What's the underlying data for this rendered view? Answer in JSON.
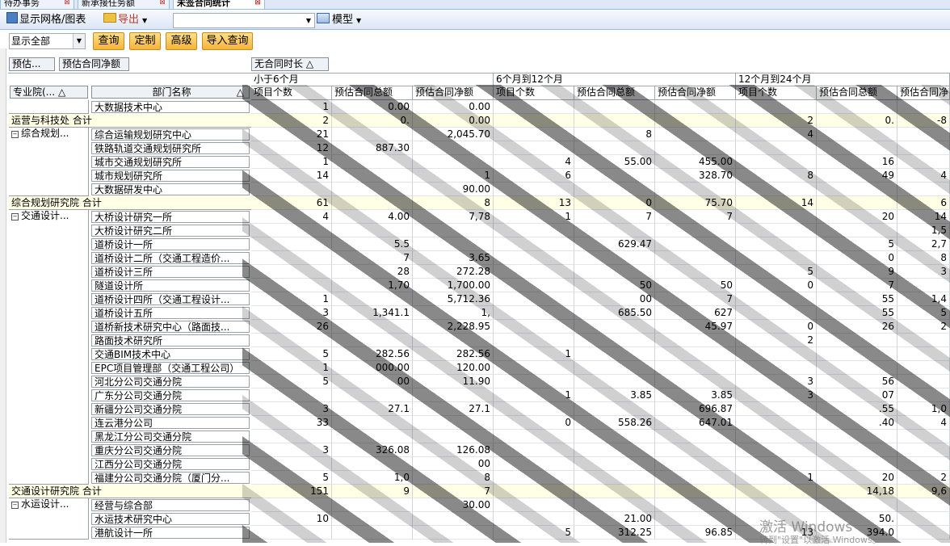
{
  "tabs": [
    {
      "label": "待办事务",
      "active": false
    },
    {
      "label": "新承接任务额",
      "active": false
    },
    {
      "label": "未签合同统计",
      "active": true
    }
  ],
  "toolbar": {
    "display_grid_chart": "显示网格/图表",
    "export": "导出",
    "search_value": "",
    "model": "模型"
  },
  "filter": {
    "show_all": "显示全部",
    "query": "查询",
    "customize": "定制",
    "advanced": "高级",
    "import_query": "导入查询"
  },
  "pivot": {
    "filter_fields": [
      "预估...",
      "预估合同净额"
    ],
    "column_field": "无合同时长 △",
    "row_fields": [
      "专业院(... △",
      "部门名称"
    ],
    "row_field_sort": "△",
    "periods": [
      "小于6个月",
      "6个月到12个月",
      "12个月到24个月"
    ],
    "measures": [
      "项目个数",
      "预估合同总额",
      "预估合同净额"
    ],
    "rows": [
      {
        "group": "",
        "dept": "大数据技术中心",
        "v": [
          "1",
          "0.00",
          "0.00",
          "",
          "",
          "",
          "",
          "",
          ""
        ],
        "total": false
      },
      {
        "group": "运营与科技处 合计",
        "dept": "",
        "v": [
          "2",
          "0.",
          "0.00",
          "",
          "",
          "",
          "2",
          "0.",
          "-8"
        ],
        "total": true
      },
      {
        "group": "综合规划...",
        "dept": "综合运输规划研究中心",
        "v": [
          "21",
          "",
          "2,045.70",
          "",
          "8",
          "",
          "4",
          "",
          ""
        ],
        "total": false,
        "expand": true
      },
      {
        "group": "",
        "dept": "铁路轨道交通规划研究所",
        "v": [
          "12",
          "887.30",
          "",
          "",
          "",
          "",
          "",
          "",
          ""
        ],
        "total": false
      },
      {
        "group": "",
        "dept": "城市交通规划研究所",
        "v": [
          "1",
          "",
          "",
          "4",
          "55.00",
          "455.00",
          "",
          "16",
          ""
        ],
        "total": false
      },
      {
        "group": "",
        "dept": "城市规划研究所",
        "v": [
          "14",
          "",
          "1",
          "6",
          "",
          "328.70",
          "8",
          "49",
          "4"
        ],
        "total": false
      },
      {
        "group": "",
        "dept": "大数据研发中心",
        "v": [
          "",
          "",
          "90.00",
          "",
          "",
          "",
          "",
          "",
          ""
        ],
        "total": false
      },
      {
        "group": "综合规划研究院 合计",
        "dept": "",
        "v": [
          "61",
          "",
          "8",
          "13",
          "0",
          "75.70",
          "14",
          "",
          "6"
        ],
        "total": true
      },
      {
        "group": "交通设计...",
        "dept": "大桥设计研究一所",
        "v": [
          "4",
          "4.00",
          "7,78",
          "1",
          "7",
          "7",
          "",
          "20",
          "14"
        ],
        "total": false,
        "expand": true
      },
      {
        "group": "",
        "dept": "大桥设计研究二所",
        "v": [
          "",
          "",
          "",
          "",
          "",
          "",
          "",
          "",
          "1,5"
        ],
        "total": false
      },
      {
        "group": "",
        "dept": "道桥设计一所",
        "v": [
          "",
          "5.5",
          "",
          "",
          "629.47",
          "",
          "",
          "5",
          "2,7"
        ],
        "total": false
      },
      {
        "group": "",
        "dept": "道桥设计二所（交通工程造价...",
        "v": [
          "",
          "7",
          "3.65",
          "",
          "",
          "",
          "",
          "0",
          "8"
        ],
        "total": false
      },
      {
        "group": "",
        "dept": "道桥设计三所",
        "v": [
          "",
          "28",
          "272.28",
          "",
          "",
          "",
          "5",
          "9",
          "3"
        ],
        "total": false
      },
      {
        "group": "",
        "dept": "隧道设计所",
        "v": [
          "",
          "1,70",
          "1,700.00",
          "",
          "50",
          "50",
          "0",
          "7",
          ""
        ],
        "total": false
      },
      {
        "group": "",
        "dept": "道桥设计四所（交通工程设计...",
        "v": [
          "1",
          "",
          "5,712.36",
          "",
          "00",
          "7",
          "",
          "55",
          "1,4"
        ],
        "total": false
      },
      {
        "group": "",
        "dept": "道桥设计五所",
        "v": [
          "3",
          "1,341.1",
          "1,",
          "",
          "685.50",
          "627",
          "",
          "55",
          "5"
        ],
        "total": false
      },
      {
        "group": "",
        "dept": "道桥新技术研究中心（路面技...",
        "v": [
          "26",
          "",
          "2,228.95",
          "",
          "",
          "45.97",
          "0",
          "26",
          "2"
        ],
        "total": false
      },
      {
        "group": "",
        "dept": "路面技术研究所",
        "v": [
          "",
          "",
          "",
          "",
          "",
          "",
          "2",
          "",
          ""
        ],
        "total": false
      },
      {
        "group": "",
        "dept": "交通BIM技术中心",
        "v": [
          "5",
          "282.56",
          "282.56",
          "1",
          "",
          "",
          "",
          "",
          ""
        ],
        "total": false
      },
      {
        "group": "",
        "dept": "EPC项目管理部（交通工程公司）",
        "v": [
          "1",
          "000.00",
          "120.00",
          "",
          "",
          "",
          "",
          "",
          ""
        ],
        "total": false
      },
      {
        "group": "",
        "dept": "河北分公司交通分院",
        "v": [
          "5",
          "00",
          "11.90",
          "",
          "",
          "",
          "3",
          "56",
          ""
        ],
        "total": false
      },
      {
        "group": "",
        "dept": "广东分公司交通分院",
        "v": [
          "",
          "",
          "",
          "1",
          "3.85",
          "3.85",
          "3",
          "07",
          ""
        ],
        "total": false
      },
      {
        "group": "",
        "dept": "新疆分公司交通分院",
        "v": [
          "3",
          "27.1",
          "27.1",
          "",
          "",
          "696.87",
          "",
          ".55",
          "1,0"
        ],
        "total": false
      },
      {
        "group": "",
        "dept": "连云港分公司",
        "v": [
          "33",
          "",
          "",
          "0",
          "558.26",
          "647.01",
          "",
          ".40",
          "4"
        ],
        "total": false
      },
      {
        "group": "",
        "dept": "黑龙江分公司交通分院",
        "v": [
          "",
          "",
          "",
          "",
          "",
          "",
          "",
          "",
          ""
        ],
        "total": false
      },
      {
        "group": "",
        "dept": "重庆分公司交通分院",
        "v": [
          "3",
          "326.08",
          "126.08",
          "",
          "",
          "",
          "",
          "",
          ""
        ],
        "total": false
      },
      {
        "group": "",
        "dept": "江西分公司交通分院",
        "v": [
          "",
          "",
          "00",
          "",
          "",
          "",
          "",
          "",
          ""
        ],
        "total": false
      },
      {
        "group": "",
        "dept": "福建分公司交通分院（厦门分...",
        "v": [
          "5",
          "1,0",
          "8",
          "",
          "",
          "",
          "1",
          "20",
          "2"
        ],
        "total": false
      },
      {
        "group": "交通设计研究院 合计",
        "dept": "",
        "v": [
          "151",
          "9",
          "7",
          "",
          "",
          "",
          "",
          "14,18",
          "9,6"
        ],
        "total": true
      },
      {
        "group": "水运设计...",
        "dept": "经营与综合部",
        "v": [
          "",
          "",
          "30.00",
          "",
          "",
          "",
          "",
          "",
          ""
        ],
        "total": false,
        "expand": true
      },
      {
        "group": "",
        "dept": "水运技术研究中心",
        "v": [
          "10",
          "",
          "",
          "",
          "21.00",
          "",
          "",
          "50.",
          ""
        ],
        "total": false
      },
      {
        "group": "",
        "dept": "港航设计一所",
        "v": [
          "",
          "",
          "",
          "5",
          "312.25",
          "96.85",
          "13",
          "394.0",
          ""
        ],
        "total": false
      }
    ]
  },
  "watermark": {
    "line1": "激活 Windows",
    "line2": "转到\"设置\"以激活 Windows。"
  },
  "colors": {
    "total_band": "#ffffe6",
    "button_orange": "#f5b339",
    "toolbar_blue": "#dce6f4"
  }
}
